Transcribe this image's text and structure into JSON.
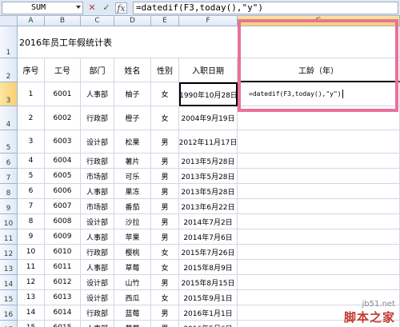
{
  "formula_bar": {
    "name_box": "SUM",
    "cancel": "✕",
    "enter": "✓",
    "fx": "fx",
    "formula": "=datedif(F3,today(),\"y\")"
  },
  "columns": [
    "A",
    "B",
    "C",
    "D",
    "E",
    "F",
    "G"
  ],
  "selected_column": "G",
  "rows": [
    "1",
    "2",
    "3",
    "4",
    "5",
    "6",
    "7",
    "8",
    "9",
    "10",
    "11",
    "12",
    "13",
    "14",
    "15",
    "16",
    "17"
  ],
  "selected_row": "3",
  "sheet": {
    "title": "2016年员工年假统计表",
    "headers": {
      "seq": "序号",
      "emp_no": "工号",
      "dept": "部门",
      "name": "姓名",
      "gender": "性别",
      "hire_date": "入职日期",
      "seniority": "工龄（年）"
    },
    "editing_formula": "=datedif(F3,today(),\"y\")",
    "records": [
      {
        "seq": "1",
        "emp_no": "6001",
        "dept": "人事部",
        "name": "柚子",
        "gender": "女",
        "hire_date": "1990年10月28日"
      },
      {
        "seq": "2",
        "emp_no": "6002",
        "dept": "行政部",
        "name": "橙子",
        "gender": "女",
        "hire_date": "2004年9月19日"
      },
      {
        "seq": "3",
        "emp_no": "6003",
        "dept": "设计部",
        "name": "松果",
        "gender": "男",
        "hire_date": "2012年11月17日"
      },
      {
        "seq": "4",
        "emp_no": "6004",
        "dept": "行政部",
        "name": "薯片",
        "gender": "男",
        "hire_date": "2013年5月28日"
      },
      {
        "seq": "5",
        "emp_no": "6005",
        "dept": "市场部",
        "name": "可乐",
        "gender": "男",
        "hire_date": "2013年5月28日"
      },
      {
        "seq": "6",
        "emp_no": "6006",
        "dept": "人事部",
        "name": "果冻",
        "gender": "男",
        "hire_date": "2013年5月28日"
      },
      {
        "seq": "7",
        "emp_no": "6007",
        "dept": "市场部",
        "name": "番茄",
        "gender": "男",
        "hire_date": "2013年6月22日"
      },
      {
        "seq": "8",
        "emp_no": "6008",
        "dept": "设计部",
        "name": "沙拉",
        "gender": "男",
        "hire_date": "2014年7月2日"
      },
      {
        "seq": "9",
        "emp_no": "6009",
        "dept": "人事部",
        "name": "苹果",
        "gender": "男",
        "hire_date": "2014年7月6日"
      },
      {
        "seq": "10",
        "emp_no": "6010",
        "dept": "行政部",
        "name": "樱桃",
        "gender": "女",
        "hire_date": "2015年7月26日"
      },
      {
        "seq": "11",
        "emp_no": "6011",
        "dept": "人事部",
        "name": "草莓",
        "gender": "女",
        "hire_date": "2015年8月9日"
      },
      {
        "seq": "12",
        "emp_no": "6012",
        "dept": "设计部",
        "name": "山竹",
        "gender": "男",
        "hire_date": "2015年8月15日"
      },
      {
        "seq": "13",
        "emp_no": "6013",
        "dept": "设计部",
        "name": "西瓜",
        "gender": "女",
        "hire_date": "2015年9月1日"
      },
      {
        "seq": "14",
        "emp_no": "6014",
        "dept": "行政部",
        "name": "蓝莓",
        "gender": "男",
        "hire_date": "2016年1月1日"
      },
      {
        "seq": "15",
        "emp_no": "6015",
        "dept": "人事部",
        "name": "葡萄",
        "gender": "男",
        "hire_date": "2016年5月6日"
      }
    ]
  },
  "watermark": {
    "url": "jb51.net",
    "name": "脚本之家"
  }
}
